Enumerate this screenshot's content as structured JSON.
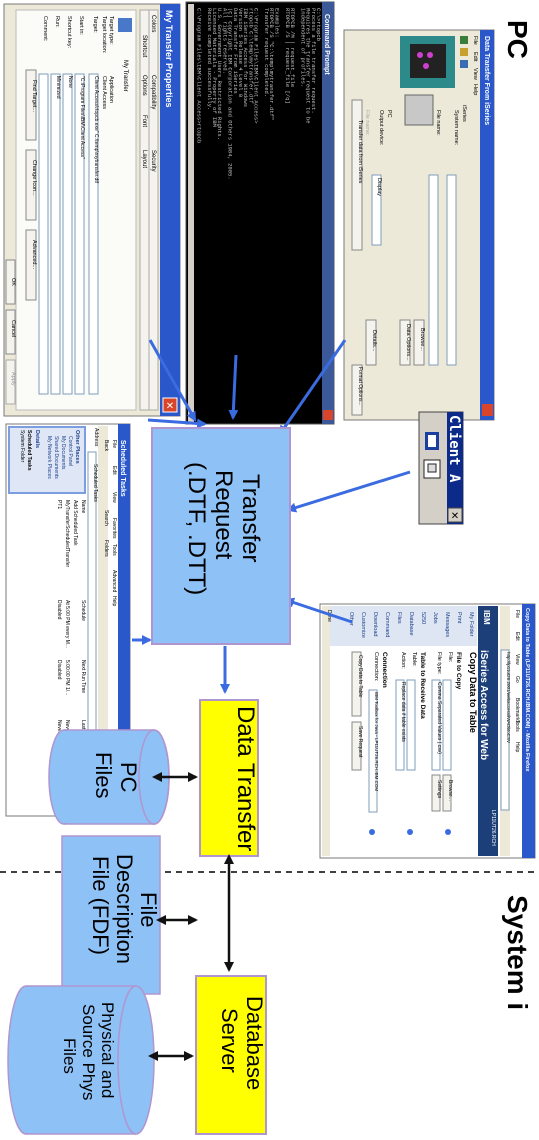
{
  "labels": {
    "pc_heading": "PC",
    "system_heading": "System i",
    "transfer_request_line1": "Transfer",
    "transfer_request_line2": "Request",
    "transfer_request_line3": "(.DTF, .DTT)",
    "data_transfer": "Data Transfer",
    "pc_files_line1": "PC",
    "pc_files_line2": "Files",
    "fdf_line1": "File",
    "fdf_line2": "Description",
    "fdf_line3": "File (FDF)",
    "db_server_line1": "Database",
    "db_server_line2": "Server",
    "phys_line1": "Physical and",
    "phys_line2": "Source Phys",
    "phys_line3": "Files",
    "client_access": "Client A"
  },
  "screenshots": {
    "properties_title": "My Transfer Properties",
    "properties_tabs": [
      "Colors",
      "Shortcut",
      "Compatibility",
      "Options",
      "Security",
      "Layout",
      "Font",
      "General"
    ],
    "properties_fields": [
      {
        "label": "Target type:",
        "value": "Application"
      },
      {
        "label": "Target location:",
        "value": "Client Access"
      },
      {
        "label": "Target:",
        "value": "Client Access\\rtopcb.exe\" C:\\temp\\mytransfer.dtf"
      },
      {
        "label": "Start in:",
        "value": "\"C:\\Program Files\\IBM\\Client Access\""
      },
      {
        "label": "Shortcut key:",
        "value": "None"
      },
      {
        "label": "Run:",
        "value": "Minimized"
      },
      {
        "label": "Comment:",
        "value": ""
      }
    ],
    "properties_name": "My Transfer",
    "properties_buttons": [
      "Find Target...",
      "Change Icon...",
      "Advanced..."
    ],
    "dialog_buttons": [
      "OK",
      "Cancel",
      "Apply"
    ],
    "cmd_title": "Command Prompt",
    "cmd_lines": [
      "C:\\>rtopcb",
      "Process a file transfer request.",
      "Requires the transfer request to be",
      "independent of profiles.",
      "",
      "RTOPCB /M | request_file",
      "RTOPCB /S | request_file [/q]",
      "",
      "Examples:",
      "RTOPCB /S \"C:\\temp\\mytransfer.dtf\"",
      "Transfer request completed.",
      "",
      "C:\\Program Files\\IBM\\Client Access>",
      "  rtopcb C:\\temp\\mytransfer.dtf",
      "IBM iSeries Access for Windows",
      "Version 5 Release 4 Level 0",
      "Data Transfer From iSeries",
      "(C) Copyright IBM Corporation and Others 1984, 2005.",
      "All rights reserved.",
      "U.S. Government Users Restricted Rights.",
      "Licensed Materials - Property of IBM",
      "Receive completed successfully.",
      "",
      "C:\\Program Files\\IBM\\Client Access>rtopcb"
    ],
    "dt_title": "Data Transfer From iSeries",
    "dt_menu": [
      "File",
      "Edit",
      "View",
      "Help"
    ],
    "dt_labels": [
      "iSeries",
      "System name:",
      "File name:",
      "PC",
      "Output device:",
      "File name:"
    ],
    "dt_output_device": "Display",
    "dt_buttons": [
      "Browse...",
      "Data Options...",
      "Details...",
      "Format Options...",
      "Transfer data from iSeries"
    ],
    "sched_title": "Scheduled Tasks",
    "sched_menu": [
      "File",
      "Edit",
      "View",
      "Favorites",
      "Tools",
      "Advanced",
      "Help"
    ],
    "sched_toolbar": [
      "Back",
      "Search",
      "Folders"
    ],
    "sched_address_label": "Address",
    "sched_address": "Scheduled Tasks",
    "sched_go": "Go",
    "sched_columns": [
      "Name",
      "Schedule",
      "Next Run Time",
      "Last Run Time",
      "Status"
    ],
    "sched_rows": [
      [
        "Add Scheduled Task",
        "",
        "",
        "",
        ""
      ],
      [
        "MyTransferScheduledTransfer",
        "At 5:00 PM every M...",
        "5:00:00 PM 1/...",
        "Never",
        ""
      ],
      [
        "PT1",
        "Disabled",
        "Disabled",
        "Never",
        ""
      ]
    ],
    "sched_other_places_title": "Other Places",
    "sched_other_places": [
      "Control Panel",
      "My Documents",
      "Shared Documents",
      "My Network Places"
    ],
    "sched_details_title": "Details",
    "sched_details": [
      "Scheduled Tasks",
      "System Folder"
    ],
    "ff_title": "Copy Data to Table (LP11UT26.RCH.IBM.COM) - Mozilla Firefox",
    "ff_menu": [
      "File",
      "Edit",
      "View",
      "Go",
      "Bookmarks",
      "Tools",
      "Help"
    ],
    "ff_url": "http://lp11ut26:2001/webaccess/iWADbtoCSV",
    "ff_brand": "iSeries Access for Web",
    "ff_ibm": "IBM",
    "ff_host": "LP11UT26.RCH",
    "ff_nav": [
      "My Folder",
      "Print",
      "Messages",
      "Jobs",
      "5250",
      "Database",
      "Files",
      "Command",
      "Download",
      "Customize",
      "Other"
    ],
    "ff_heading": "Copy Data to Table",
    "ff_file_section": "File to Copy",
    "ff_file_labels": [
      "File:",
      "File type:"
    ],
    "ff_file_type": "Comma Separated Values (.csv)",
    "ff_browse": "Browse...",
    "ff_settings": "Settings",
    "ff_table_section": "Table to Receive Data",
    "ff_table_labels": [
      "Table:",
      "Action:"
    ],
    "ff_action": "Replace data if table exists",
    "ff_conn_section": "Connection",
    "ff_conn_label": "Connection:",
    "ff_conn_value": "IBM Toolbox for Java - LP11UT26.RCH.IBM.COM",
    "ff_buttons": [
      "Copy Data to Table",
      "Save Request"
    ],
    "ff_status": "Done"
  }
}
